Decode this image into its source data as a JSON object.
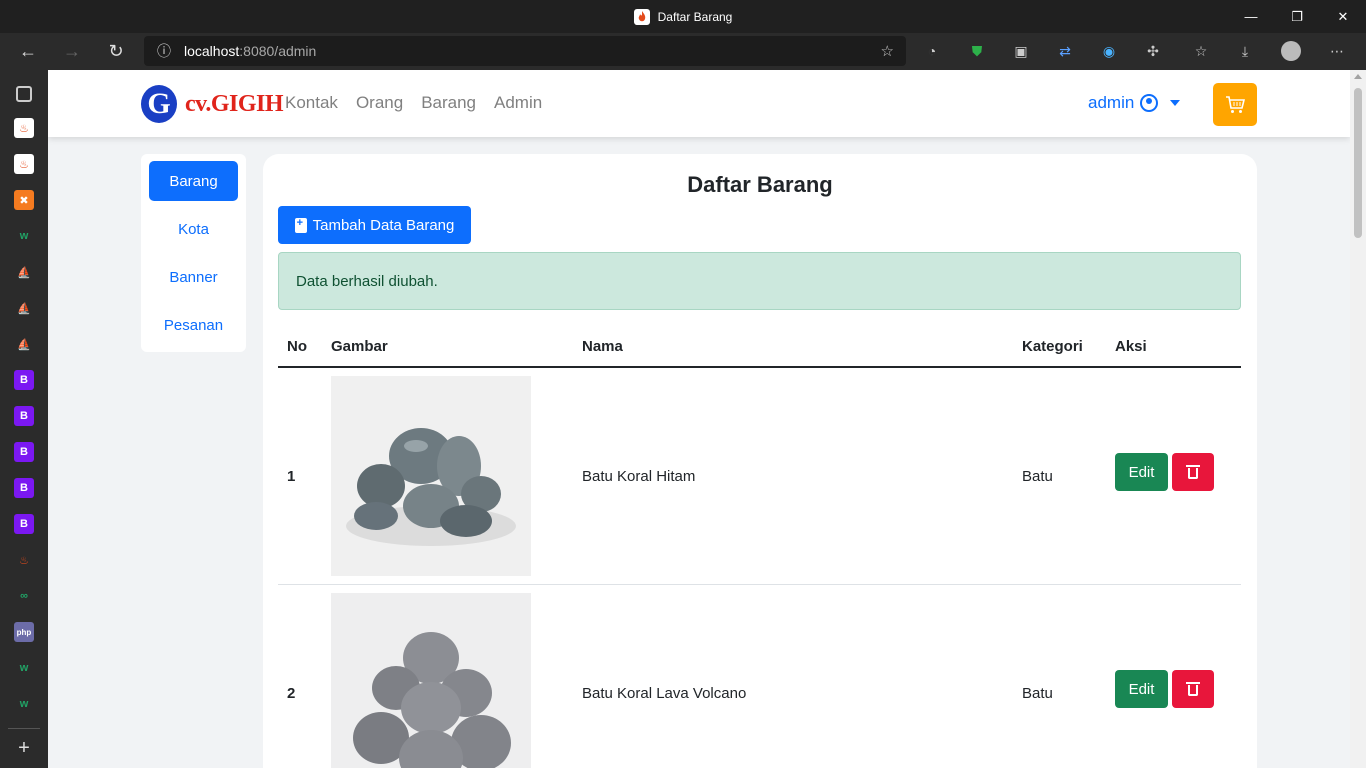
{
  "browser": {
    "tab_title": "Daftar Barang",
    "url_host": "localhost",
    "url_path": ":8080/admin",
    "controls": {
      "minimize": "—",
      "maximize": "❐",
      "close": "✕"
    }
  },
  "site": {
    "logo_letter": "G",
    "logo_text": "cv.GIGIH",
    "menu": [
      "Kontak",
      "Orang",
      "Barang",
      "Admin"
    ],
    "user": "admin",
    "colors": {
      "primary": "#0d6efd",
      "cart": "#ffa500",
      "success": "#198754",
      "danger": "#e8163b"
    }
  },
  "sidebar_menu": {
    "items": [
      "Barang",
      "Kota",
      "Banner",
      "Pesanan"
    ],
    "active": "Barang"
  },
  "main": {
    "heading": "Daftar Barang",
    "add_button": "Tambah Data Barang",
    "alert": "Data berhasil diubah.",
    "columns": [
      "No",
      "Gambar",
      "Nama",
      "Kategori",
      "Aksi"
    ],
    "rows": [
      {
        "no": "1",
        "nama": "Batu Koral Hitam",
        "kategori": "Batu",
        "edit": "Edit"
      },
      {
        "no": "2",
        "nama": "Batu Koral Lava Volcano",
        "kategori": "Batu",
        "edit": "Edit"
      }
    ]
  }
}
